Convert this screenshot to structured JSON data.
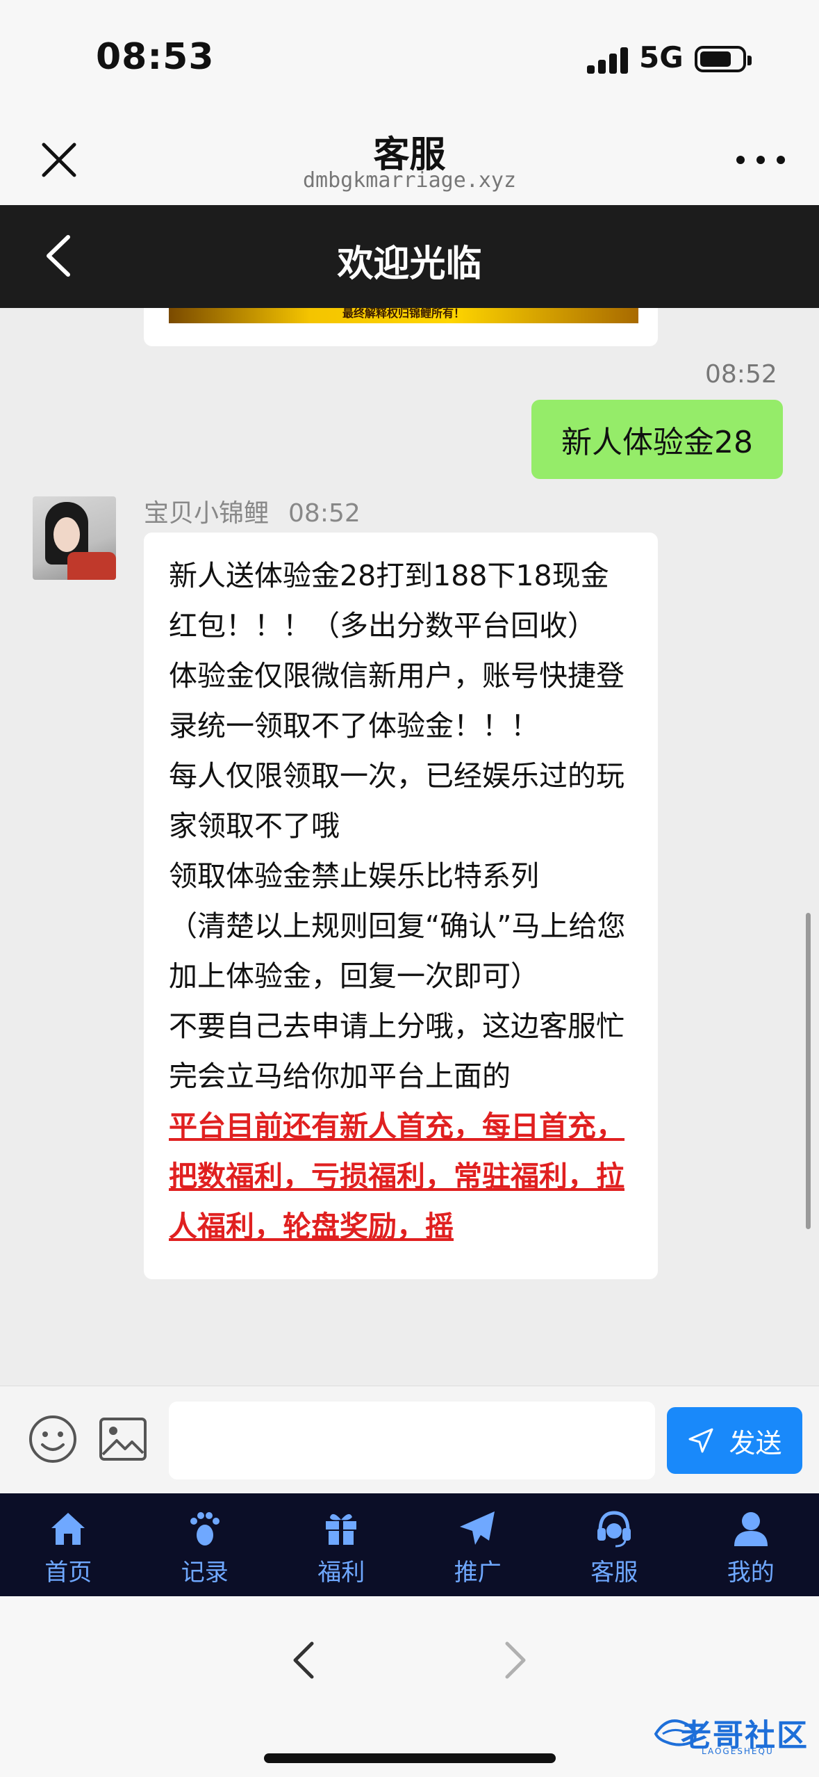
{
  "status_bar": {
    "time": "08:53",
    "network": "5G"
  },
  "wechat_bar": {
    "title": "客服",
    "url": "dmbgkmarriage.xyz"
  },
  "page_header": {
    "title": "欢迎光临"
  },
  "chat": {
    "top_image_caption": "最终解释权归锦鲤所有！",
    "outgoing": {
      "time": "08:52",
      "text": "新人体验金28"
    },
    "incoming": {
      "sender": "宝贝小锦鲤",
      "time": "08:52",
      "lines": [
        "新人送体验金28打到188下18现金红包！！！（多出分数平台回收）",
        "体验金仅限微信新用户，账号快捷登录统一领取不了体验金！！！",
        "每人仅限领取一次，已经娱乐过的玩家领取不了哦",
        "领取体验金禁止娱乐比特系列",
        "（清楚以上规则回复“确认”马上给您加上体验金，回复一次即可）",
        "不要自己去申请上分哦，这边客服忙完会立马给你加平台上面的"
      ],
      "highlight": "平台目前还有新人首充，每日首充，把数福利，亏损福利，常驻福利，拉人福利，轮盘奖励，摇"
    }
  },
  "composer": {
    "placeholder": "",
    "send_label": "发送"
  },
  "bottom_nav": [
    {
      "label": "首页",
      "icon": "home-icon"
    },
    {
      "label": "记录",
      "icon": "footprint-icon"
    },
    {
      "label": "福利",
      "icon": "gift-icon"
    },
    {
      "label": "推广",
      "icon": "paper-plane-icon"
    },
    {
      "label": "客服",
      "icon": "headset-icon"
    },
    {
      "label": "我的",
      "icon": "user-icon"
    }
  ],
  "watermark": {
    "text": "老哥社区",
    "sub": "LAOGESHEQU"
  },
  "colors": {
    "send_button": "#1989fa",
    "nav_bg": "#0b0e27",
    "nav_accent": "#6fa8ff",
    "outgoing_bubble": "#95ec69",
    "highlight_red": "#e02020"
  }
}
